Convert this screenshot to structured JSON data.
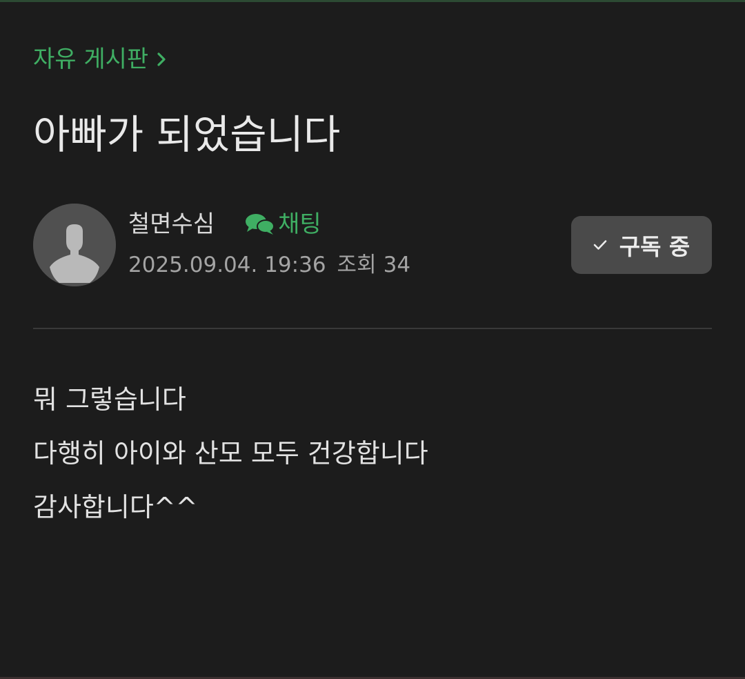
{
  "board": {
    "name": "자유 게시판",
    "chevron_icon": "chevron-right-icon"
  },
  "post": {
    "title": "아빠가 되었습니다",
    "author": {
      "name": "철면수심",
      "avatar_icon": "default-user-avatar-icon"
    },
    "chat": {
      "label": "채팅",
      "icon": "chat-bubbles-icon"
    },
    "date": "2025.09.04. 19:36",
    "views_label": "조회",
    "views_count": "34",
    "subscribe": {
      "label": "구독 중",
      "icon": "check-icon"
    },
    "body": [
      "뭐 그렇습니다",
      "다행히 아이와 산모 모두 건강합니다",
      "감사합니다^^"
    ]
  },
  "colors": {
    "background": "#1c1c1c",
    "accent_green": "#3fae63",
    "title_text": "#e9e9e9",
    "meta_text": "#a4a4a4",
    "button_bg": "#4a4a4a",
    "divider": "#393939"
  }
}
